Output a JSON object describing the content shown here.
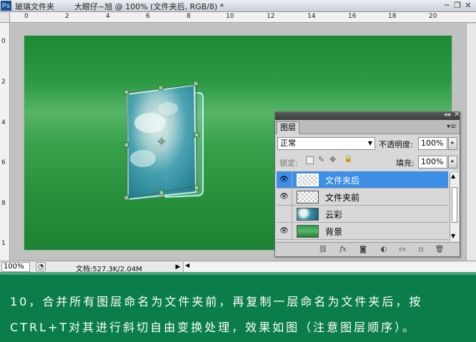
{
  "titlebar": {
    "folder_title": "玻璃文件夹",
    "doc_title": "大眼仔~旭 @ 100% (文件夹后, RGB/8) *",
    "minimize": "─",
    "restore": "❐",
    "close": "✕"
  },
  "ruler": {
    "top_numbers": [
      "0",
      "2",
      "4",
      "6",
      "8",
      "10",
      "12",
      "14",
      "16",
      "18",
      "20"
    ],
    "left_numbers": [
      "0",
      "2",
      "4",
      "6",
      "8",
      "1"
    ]
  },
  "layers_panel": {
    "tab_label": "图层",
    "blend_mode": "正常",
    "opacity_label": "不透明度:",
    "opacity_value": "100%",
    "lock_label": "锁定:",
    "fill_label": "填充:",
    "fill_value": "100%",
    "layers": [
      {
        "name": "文件夹后",
        "visible": true,
        "selected": true,
        "thumb": "transparent"
      },
      {
        "name": "文件夹前",
        "visible": true,
        "selected": false,
        "thumb": "transparent"
      },
      {
        "name": "云彩",
        "visible": false,
        "selected": false,
        "thumb": "cloud"
      },
      {
        "name": "背景",
        "visible": true,
        "selected": false,
        "thumb": "green"
      }
    ],
    "bottom_icons": [
      "link-icon",
      "fx-icon",
      "mask-icon",
      "adjustment-icon",
      "group-icon",
      "new-layer-icon",
      "trash-icon"
    ]
  },
  "statusbar": {
    "zoom": "100%",
    "doc_info": "文档:527.3K/2.04M"
  },
  "caption": {
    "line1": "10，合并所有图层命名为文件夹前，再复制一层命名为文件夹后，按",
    "line2": "CTRL+T对其进行斜切自由变换处理，效果如图（注意图层顺序）。"
  },
  "colors": {
    "canvas_green": "#2a9a44",
    "selected_layer": "#3d8ee6",
    "caption_bg": "#0b7d4b"
  }
}
